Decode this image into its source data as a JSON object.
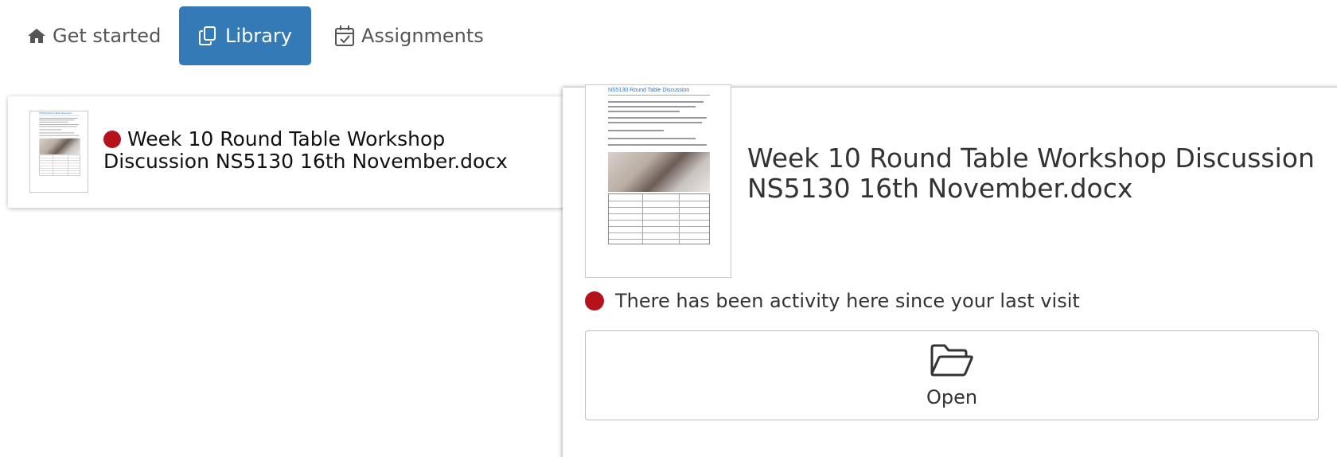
{
  "tabs": [
    {
      "label": "Get started",
      "icon": "home-icon",
      "active": false
    },
    {
      "label": "Library",
      "icon": "copy-icon",
      "active": true
    },
    {
      "label": "Assignments",
      "icon": "calendar-check-icon",
      "active": false
    }
  ],
  "colors": {
    "active_tab": "#337ab7",
    "activity_dot": "#b5121b",
    "doc_heading": "#2e74b5"
  },
  "list_item": {
    "title": "Week 10 Round Table Workshop Discussion NS5130 16th November.docx",
    "has_activity": true,
    "thumbnail": "document-thumbnail"
  },
  "preview": {
    "doc_heading": "NS5130 Round Table Discussion",
    "title": "Week 10 Round Table Workshop Discussion NS5130 16th November.docx",
    "activity_text": "There has been activity here since your last visit",
    "open_label": "Open",
    "open_icon": "folder-open-icon"
  }
}
